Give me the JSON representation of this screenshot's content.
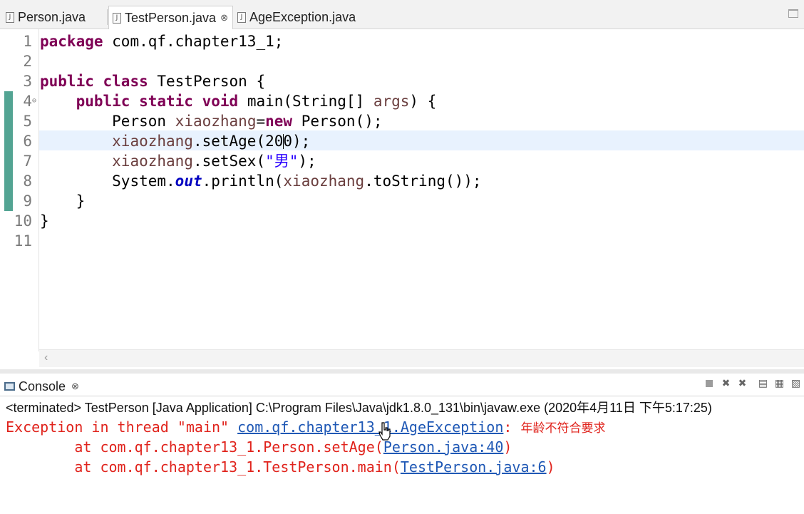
{
  "tabs": [
    {
      "label": "Person.java",
      "active": false
    },
    {
      "label": "TestPerson.java",
      "active": true
    },
    {
      "label": "AgeException.java",
      "active": false
    }
  ],
  "tab_close_glyph": "⊗",
  "editor": {
    "line_numbers": [
      "1",
      "2",
      "3",
      "4",
      "5",
      "6",
      "7",
      "8",
      "9",
      "10",
      "11"
    ],
    "code": {
      "l1_kw": "package",
      "l1_rest": " com.qf.chapter13_1;",
      "l3_kw1": "public",
      "l3_kw2": "class",
      "l3_rest": " TestPerson {",
      "l4_kw1": "public",
      "l4_kw2": "static",
      "l4_kw3": "void",
      "l4_a": " main(String[] ",
      "l4_args": "args",
      "l4_b": ") {",
      "l5_a": "Person ",
      "l5_var": "xiaozhang",
      "l5_eq": "=",
      "l5_kw": "new",
      "l5_b": " Person();",
      "l6_var": "xiaozhang",
      "l6_a": ".setAge(20",
      "l6_b": "0);",
      "l7_var": "xiaozhang",
      "l7_a": ".setSex(",
      "l7_str": "\"男\"",
      "l7_b": ");",
      "l8_a": "System.",
      "l8_out": "out",
      "l8_b": ".println(",
      "l8_var": "xiaozhang",
      "l8_c": ".toString());",
      "l9": "}",
      "l10": "}"
    }
  },
  "console": {
    "tab_label": "Console",
    "terminated_line": "<terminated> TestPerson [Java Application] C:\\Program Files\\Java\\jdk1.8.0_131\\bin\\javaw.exe (2020年4月11日 下午5:17:25)",
    "exception_prefix": "Exception in thread \"main\" ",
    "exception_link": "com.qf.chapter13_1.AgeException",
    "exception_colon": ": ",
    "exception_message": "年龄不符合要求",
    "trace": [
      {
        "prefix": "        at com.qf.chapter13_1.Person.setAge(",
        "link": "Person.java:40",
        "suffix": ")"
      },
      {
        "prefix": "        at com.qf.chapter13_1.TestPerson.main(",
        "link": "TestPerson.java:6",
        "suffix": ")"
      }
    ],
    "toolbar_icons": [
      "terminate-icon",
      "remove-launch-icon",
      "remove-all-icon",
      "scroll-lock-icon",
      "show-on-output-icon",
      "pin-console-icon"
    ]
  },
  "colors": {
    "keyword": "#7f0055",
    "local_variable": "#6a3e3e",
    "string": "#2a00ff",
    "static_field": "#0000c0",
    "error_text": "#e0231c",
    "link": "#1f58b5",
    "quick_diff": "#53a493",
    "current_line": "#e8f2fe"
  }
}
